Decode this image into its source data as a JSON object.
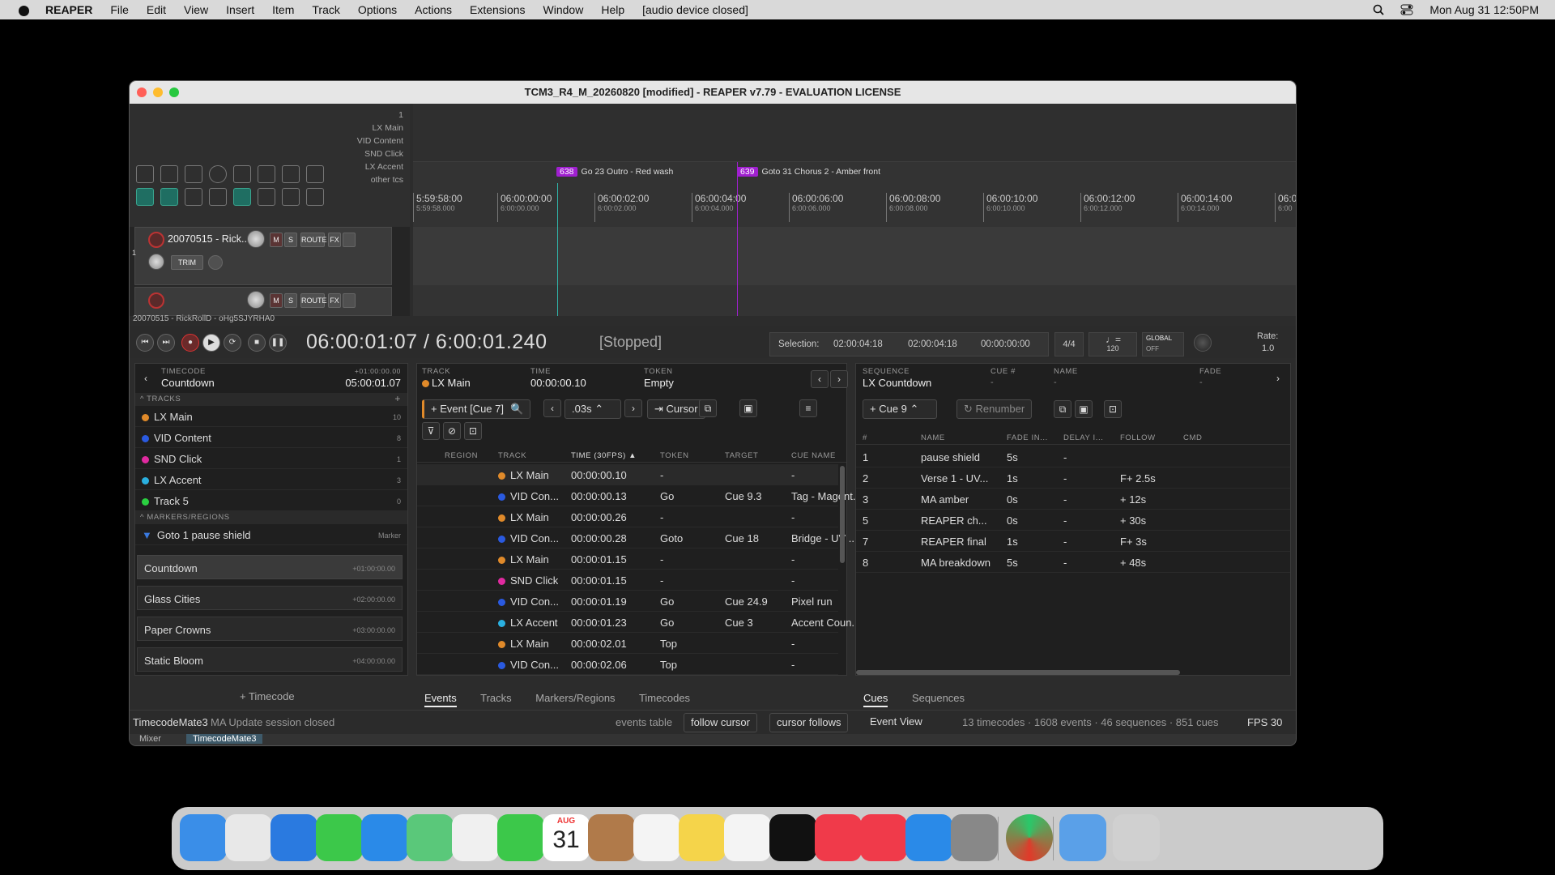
{
  "menubar": {
    "app": "REAPER",
    "items": [
      "File",
      "Edit",
      "View",
      "Insert",
      "Item",
      "Track",
      "Options",
      "Actions",
      "Extensions",
      "Window",
      "Help",
      "[audio device closed]"
    ],
    "datetime": "Mon Aug 31  12:50PM",
    "icons": [
      "apple-icon",
      "search-icon",
      "control-center-icon"
    ]
  },
  "window": {
    "title": "TCM3_R4_M_20260820 [modified] - REAPER v7.79 - EVALUATION LICENSE"
  },
  "arrange": {
    "track_counter": "1",
    "track_names": [
      "LX Main",
      "VID Content",
      "SND Click",
      "LX Accent",
      "other tcs"
    ],
    "markers": [
      {
        "id": "638",
        "label": "Go 23 Outro - Red wash"
      },
      {
        "id": "639",
        "label": "Goto 31 Chorus 2 - Amber front"
      }
    ],
    "ruler_ticks": [
      {
        "main": "5:59:58:00",
        "sub": "5:59:58.000"
      },
      {
        "main": "06:00:00:00",
        "sub": "6:00:00.000"
      },
      {
        "main": "06:00:02:00",
        "sub": "6:00:02.000"
      },
      {
        "main": "06:00:04:00",
        "sub": "6:00:04.000"
      },
      {
        "main": "06:00:06:00",
        "sub": "6:00:06.000"
      },
      {
        "main": "06:00:08:00",
        "sub": "6:00:08.000"
      },
      {
        "main": "06:00:10:00",
        "sub": "6:00:10.000"
      },
      {
        "main": "06:00:12:00",
        "sub": "6:00:12.000"
      },
      {
        "main": "06:00:14:00",
        "sub": "6:00:14.000"
      },
      {
        "main": "06:0",
        "sub": "6:00"
      }
    ],
    "tracks": [
      {
        "number": "1",
        "name": "20070515 - Rick..0",
        "mute": "M",
        "solo": "S",
        "route": "ROUTE",
        "fx": "FX",
        "trim": "TRIM"
      },
      {
        "number": "",
        "name": "",
        "mute": "M",
        "solo": "S",
        "route": "ROUTE",
        "fx": "FX"
      }
    ],
    "item_label": "20070515 - RickRollD - oHg5SJYRHA0"
  },
  "transport": {
    "position": "06:00:01:07 / 6:00:01.240",
    "state": "[Stopped]",
    "selection_label": "Selection:",
    "selection_start": "02:00:04:18",
    "selection_end": "02:00:04:18",
    "selection_length": "00:00:00:00",
    "time_signature": "4/4",
    "bpm": "120",
    "global_label": "GLOBAL",
    "global_state": "OFF",
    "rate_label": "Rate:",
    "rate_value": "1.0"
  },
  "left_panel": {
    "timecode_label": "TIMECODE",
    "timecode_name": "Countdown",
    "offset_label": "+01:00:00.00",
    "offset_value": "05:00:01.07",
    "tracks_header": "TRACKS",
    "tracks": [
      {
        "name": "LX Main",
        "count": "10",
        "color": "#e08a2a"
      },
      {
        "name": "VID Content",
        "count": "8",
        "color": "#2a5ae0"
      },
      {
        "name": "SND Click",
        "count": "1",
        "color": "#e02aa0"
      },
      {
        "name": "LX Accent",
        "count": "3",
        "color": "#2ab0e0"
      },
      {
        "name": "Track 5",
        "count": "0",
        "color": "#2ad040"
      }
    ],
    "markers_header": "MARKERS/REGIONS",
    "markers": [
      {
        "name": "Goto 1 pause shield",
        "type": "Marker"
      }
    ],
    "timecodes": [
      {
        "name": "Countdown",
        "offset": "+01:00:00.00"
      },
      {
        "name": "Glass Cities",
        "offset": "+02:00:00.00"
      },
      {
        "name": "Paper Crowns",
        "offset": "+03:00:00.00"
      },
      {
        "name": "Static Bloom",
        "offset": "+04:00:00.00"
      }
    ],
    "add_timecode": "+ Timecode"
  },
  "middle_panel": {
    "track_label": "TRACK",
    "track_value": "LX Main",
    "time_label": "TIME",
    "time_value": "00:00:00.10",
    "token_label": "TOKEN",
    "token_value": "Empty",
    "event_button": "Event [Cue 7]",
    "nudge_value": ".03s",
    "cursor_button": "Cursor",
    "columns": [
      "REGION",
      "TRACK",
      "TIME (30FPS)",
      "TOKEN",
      "TARGET",
      "CUE NAME"
    ],
    "rows": [
      {
        "track": "LX Main",
        "color": "#e08a2a",
        "time": "00:00:00.10",
        "token": "-",
        "target": "",
        "cue": "-"
      },
      {
        "track": "VID Con...",
        "color": "#2a5ae0",
        "time": "00:00:00.13",
        "token": "Go",
        "target": "Cue 9.3",
        "cue": "Tag - Magent..."
      },
      {
        "track": "LX Main",
        "color": "#e08a2a",
        "time": "00:00:00.26",
        "token": "-",
        "target": "",
        "cue": "-"
      },
      {
        "track": "VID Con...",
        "color": "#2a5ae0",
        "time": "00:00:00.28",
        "token": "Goto",
        "target": "Cue 18",
        "cue": "Bridge - UV ..."
      },
      {
        "track": "LX Main",
        "color": "#e08a2a",
        "time": "00:00:01.15",
        "token": "-",
        "target": "",
        "cue": "-"
      },
      {
        "track": "SND Click",
        "color": "#e02aa0",
        "time": "00:00:01.15",
        "token": "-",
        "target": "",
        "cue": "-"
      },
      {
        "track": "VID Con...",
        "color": "#2a5ae0",
        "time": "00:00:01.19",
        "token": "Go",
        "target": "Cue 24.9",
        "cue": "Pixel run"
      },
      {
        "track": "LX Accent",
        "color": "#2ab0e0",
        "time": "00:00:01.23",
        "token": "Go",
        "target": "Cue 3",
        "cue": "Accent Coun..."
      },
      {
        "track": "LX Main",
        "color": "#e08a2a",
        "time": "00:00:02.01",
        "token": "Top",
        "target": "",
        "cue": "-"
      },
      {
        "track": "VID Con...",
        "color": "#2a5ae0",
        "time": "00:00:02.06",
        "token": "Top",
        "target": "",
        "cue": "-"
      }
    ],
    "tabs": [
      "Events",
      "Tracks",
      "Markers/Regions",
      "Timecodes"
    ]
  },
  "right_panel": {
    "sequence_label": "SEQUENCE",
    "sequence_value": "LX Countdown",
    "cue_num_label": "CUE #",
    "cue_num_value": "-",
    "name_label": "NAME",
    "name_value": "-",
    "fade_label": "FADE",
    "fade_value": "-",
    "cue_button": "+ Cue 9",
    "renumber_button": "Renumber",
    "columns": [
      "#",
      "NAME",
      "FADE IN...",
      "DELAY I...",
      "FOLLOW",
      "CMD"
    ],
    "rows": [
      {
        "num": "1",
        "name": "pause shield",
        "fade": "5s",
        "delay": "-",
        "follow": ""
      },
      {
        "num": "2",
        "name": "Verse 1 - UV...",
        "fade": "1s",
        "delay": "-",
        "follow": "F+ 2.5s"
      },
      {
        "num": "3",
        "name": "MA amber",
        "fade": "0s",
        "delay": "-",
        "follow": "+ 12s"
      },
      {
        "num": "5",
        "name": "REAPER ch...",
        "fade": "0s",
        "delay": "-",
        "follow": "+ 30s"
      },
      {
        "num": "7",
        "name": "REAPER final",
        "fade": "1s",
        "delay": "-",
        "follow": "F+ 3s"
      },
      {
        "num": "8",
        "name": "MA breakdown",
        "fade": "5s",
        "delay": "-",
        "follow": "+ 48s"
      }
    ],
    "tabs": [
      "Cues",
      "Sequences"
    ]
  },
  "statusbar": {
    "app_name": "TimecodeMate3",
    "message": "MA Update session closed",
    "events_table": "events table",
    "follow_cursor": "follow cursor",
    "cursor_follows": "cursor follows",
    "event_view": "Event View",
    "summary": "13 timecodes · 1608 events · 46 sequences · 851 cues",
    "fps": "FPS 30"
  },
  "bottom_tabs": [
    "Mixer",
    "TimecodeMate3"
  ],
  "dock": {
    "calendar_month": "AUG",
    "calendar_day": "31",
    "apps": [
      "finder-icon",
      "launchpad-icon",
      "safari-icon",
      "messages-icon",
      "mail-icon",
      "maps-icon",
      "photos-icon",
      "facetime-icon",
      "calendar-icon",
      "contacts-icon",
      "reminders-icon",
      "notes-icon",
      "freeform-icon",
      "tv-icon",
      "music-icon",
      "news-icon",
      "app-store-icon",
      "settings-icon",
      "reaper-icon",
      "downloads-icon",
      "trash-icon"
    ]
  }
}
